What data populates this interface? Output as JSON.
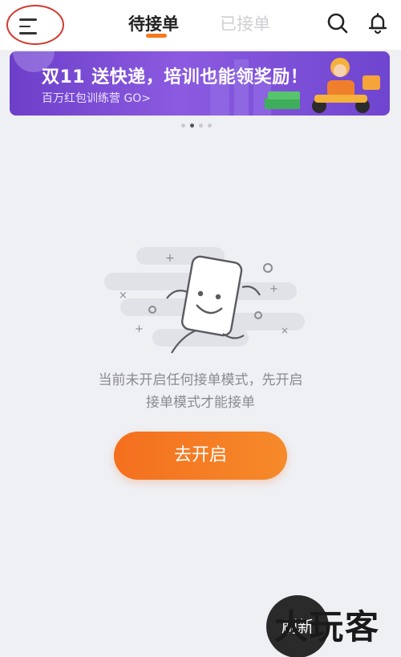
{
  "header": {
    "tabs": [
      {
        "label": "待接单",
        "active": true
      },
      {
        "label": "已接单",
        "active": false
      }
    ],
    "icons": [
      "menu-icon",
      "search-icon",
      "bell-icon"
    ]
  },
  "banner": {
    "title": "双11 送快递，培训也能领奖励！",
    "subtitle": "百万红包训练营 GO>"
  },
  "carousel": {
    "count": 4,
    "active_index": 1
  },
  "empty_state": {
    "line1": "当前未开启任何接单模式，先开启",
    "line2": "接单模式才能接单",
    "button_label": "去开启"
  },
  "refresh": {
    "label": "刷新"
  },
  "watermark": {
    "text": "大玩客"
  },
  "colors": {
    "accent": "#f47a1f",
    "banner": "#7a4ad6",
    "background": "#eff0f4",
    "annotation_circle": "#d23a2e"
  }
}
